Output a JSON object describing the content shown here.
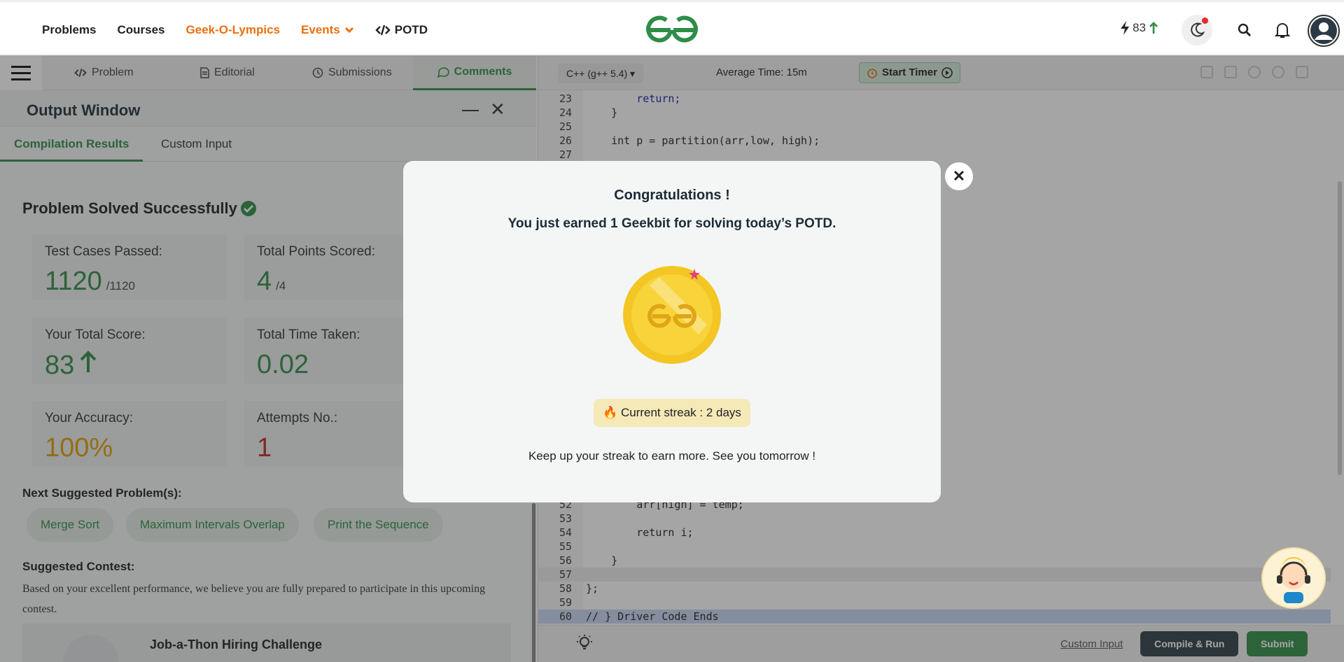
{
  "navbar": {
    "items": [
      "Problems",
      "Courses",
      "Geek-O-Lympics",
      "Events",
      "POTD"
    ],
    "streak_count": "83"
  },
  "left_tabs": [
    "Problem",
    "Editorial",
    "Submissions",
    "Comments"
  ],
  "output": {
    "title": "Output Window",
    "tabs": [
      "Compilation Results",
      "Custom Input"
    ],
    "status": "Problem Solved Successfully",
    "cards": [
      {
        "label": "Test Cases Passed:",
        "value": "1120",
        "suffix": "/1120"
      },
      {
        "label": "Total Points Scored:",
        "value": "4",
        "suffix": "/4"
      },
      {
        "label": "Your Total Score:",
        "value": "83"
      },
      {
        "label": "Total Time Taken:",
        "value": "0.02"
      },
      {
        "label": "Your Accuracy:",
        "value": "100%"
      },
      {
        "label": "Attempts No.:",
        "value": "1"
      }
    ],
    "next_label": "Next Suggested Problem(s):",
    "suggested": [
      "Merge Sort",
      "Maximum Intervals Overlap",
      "Print the Sequence"
    ],
    "contest_label": "Suggested Contest:",
    "contest_text": "Based on your excellent performance, we believe you are fully prepared to participate in this upcoming contest.",
    "contest_name": "Job-a-Thon Hiring Challenge"
  },
  "editor": {
    "language": "C++ (g++ 5.4)",
    "avg_time": "Average Time: 15m",
    "timer_label": "Start Timer",
    "lines_top": [
      {
        "n": "23",
        "text": "        return;"
      },
      {
        "n": "24",
        "text": "    }"
      },
      {
        "n": "25",
        "text": ""
      },
      {
        "n": "26",
        "text": "    int p = partition(arr,low, high);"
      },
      {
        "n": "27",
        "text": ""
      }
    ],
    "lines_bottom": [
      {
        "n": "52",
        "text": "        arr[high] = temp;"
      },
      {
        "n": "53",
        "text": ""
      },
      {
        "n": "54",
        "text": "        return i;"
      },
      {
        "n": "55",
        "text": ""
      },
      {
        "n": "56",
        "text": "    }"
      },
      {
        "n": "57",
        "text": ""
      },
      {
        "n": "58",
        "text": "};"
      },
      {
        "n": "59",
        "text": ""
      },
      {
        "n": "60",
        "text": "// } Driver Code Ends"
      }
    ],
    "custom_input": "Custom Input",
    "compile_run": "Compile & Run",
    "submit": "Submit"
  },
  "modal": {
    "title": "Congratulations !",
    "subtitle": "You just earned 1 Geekbit for solving today’s POTD.",
    "streak": "Current streak : 2 days",
    "footer": "Keep up your streak to earn more. See you tomorrow !"
  },
  "colors": {
    "brand_green": "#2f8d46",
    "orange": "#e8700f",
    "accuracy_yellow": "#e1a100",
    "attempts_red": "#c62828"
  }
}
